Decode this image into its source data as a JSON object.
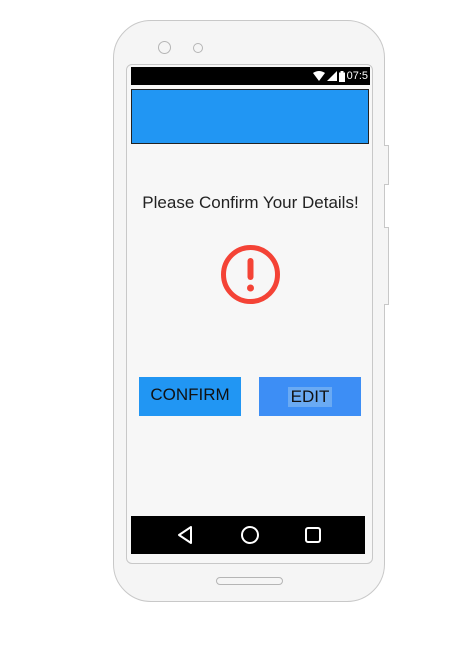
{
  "status_bar": {
    "time": "07:5",
    "icons": [
      "wifi-icon",
      "signal-icon",
      "battery-icon"
    ]
  },
  "app_bar": {
    "color": "#2196f3"
  },
  "main": {
    "title": "Please Confirm Your Details!",
    "alert_icon": "exclamation-circle-icon",
    "alert_color": "#f44336"
  },
  "actions": {
    "confirm_label": "CONFIRM",
    "edit_label": "EDIT"
  },
  "nav_bar": {
    "buttons": [
      "back-icon",
      "home-icon",
      "recent-apps-icon"
    ]
  }
}
